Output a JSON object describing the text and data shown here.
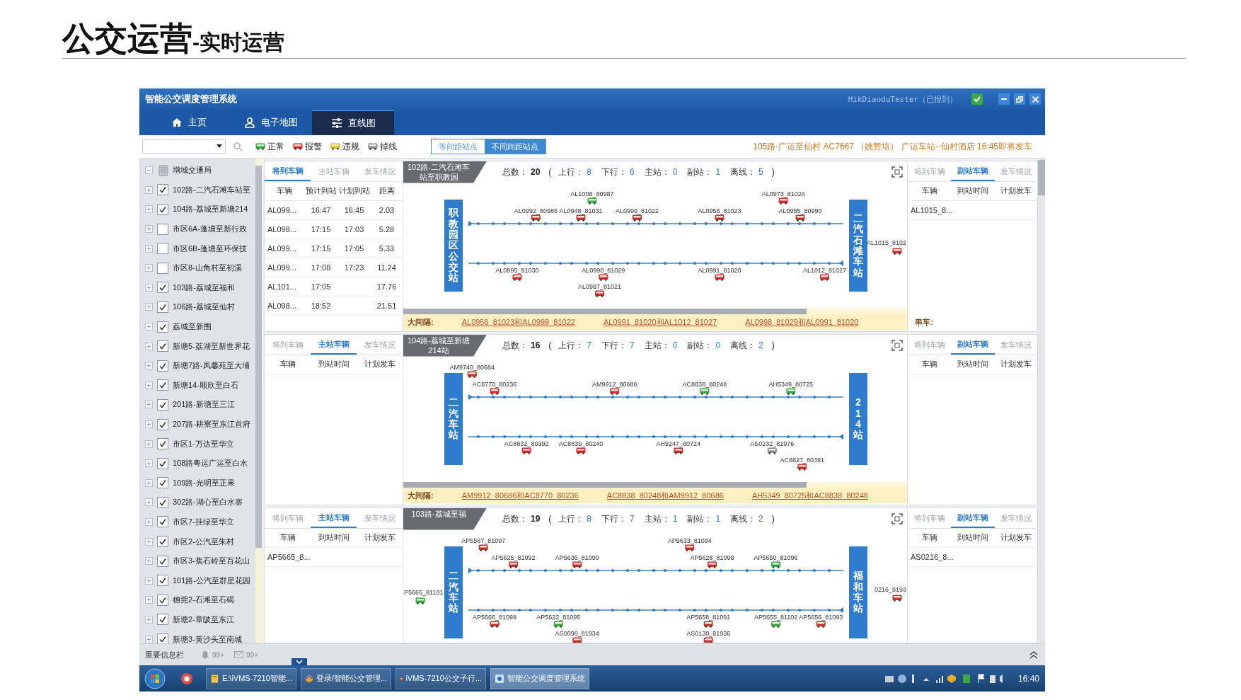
{
  "slide": {
    "title": "公交运营",
    "subtitle": "-实时运营"
  },
  "window": {
    "title": "智能公交调度管理系统",
    "user": "HikDiaoduTester（已报到）"
  },
  "tabs": [
    {
      "label": "主页",
      "selected": false
    },
    {
      "label": "电子地图",
      "selected": false
    },
    {
      "label": "直线图",
      "selected": true
    }
  ],
  "toolbar": {
    "legend": [
      {
        "label": "正常",
        "color": "#3aa845"
      },
      {
        "label": "报警",
        "color": "#c9302c"
      },
      {
        "label": "违规",
        "color": "#e2b321"
      },
      {
        "label": "掉线",
        "color": "#8a8a8a"
      }
    ],
    "view_toggle": [
      {
        "label": "等间距站点",
        "selected": false
      },
      {
        "label": "不同间距站点",
        "selected": true
      }
    ],
    "notice": "105路-广运至仙村 AC7667 （姚赞培） 广运车站--仙村酒店 16:45即将发车"
  },
  "sidebar": {
    "root": {
      "label": "增城交通局",
      "expanded": true,
      "children": [
        {
          "label": "102路-二汽石滩车站至",
          "checked": true,
          "expanded": false
        },
        {
          "label": "104路-荔城至新塘214",
          "checked": true,
          "expanded": false
        },
        {
          "label": "市区6A-蓬塘至新行政",
          "checked": false,
          "expanded": false
        },
        {
          "label": "市区6B-蓬塘至环保技",
          "checked": false,
          "expanded": false
        },
        {
          "label": "市区8-山角村至初溪",
          "checked": false,
          "expanded": false
        },
        {
          "label": "103路-荔城至福和",
          "checked": true,
          "expanded": false
        },
        {
          "label": "106路-荔城至仙村",
          "checked": true,
          "expanded": false
        },
        {
          "label": "荔城至新围",
          "checked": true,
          "expanded": false
        },
        {
          "label": "新塘5-荔湖至新世界花",
          "checked": true,
          "expanded": false
        },
        {
          "label": "新塘7路-凤馨苑至大埔",
          "checked": true,
          "expanded": false
        },
        {
          "label": "新塘14-顺欣至白石",
          "checked": true,
          "expanded": false
        },
        {
          "label": "201路-新塘至三江",
          "checked": true,
          "expanded": false
        },
        {
          "label": "207路-耕寮至东江首府",
          "checked": true,
          "expanded": false
        },
        {
          "label": "市区1-万达至华立",
          "checked": true,
          "expanded": false
        },
        {
          "label": "108路粤运广运至白水",
          "checked": true,
          "expanded": false
        },
        {
          "label": "109路-光明至正果",
          "checked": true,
          "expanded": false
        },
        {
          "label": "302路-湖心至白水寨",
          "checked": true,
          "expanded": false
        },
        {
          "label": "市区7-挂绿至华立",
          "checked": true,
          "expanded": false
        },
        {
          "label": "市区2-公汽至朱村",
          "checked": true,
          "expanded": false
        },
        {
          "label": "市区3-蕉石岭至百花山",
          "checked": true,
          "expanded": false
        },
        {
          "label": "101路-公汽至群星花园",
          "checked": true,
          "expanded": false
        },
        {
          "label": "穗莞2-石滩至石碣",
          "checked": true,
          "expanded": false
        },
        {
          "label": "新塘2-章陂至东江",
          "checked": true,
          "expanded": false
        },
        {
          "label": "新塘3-黄沙头至南城",
          "checked": true,
          "expanded": false
        }
      ]
    }
  },
  "panels": [
    {
      "left": {
        "tabs": [
          {
            "label": "将到车辆",
            "selected": true
          },
          {
            "label": "主站车辆",
            "selected": false
          },
          {
            "label": "发车情况",
            "selected": false
          }
        ],
        "columns": [
          "车辆",
          "预计到站",
          "计划到站",
          "距离"
        ],
        "rows": [
          [
            "AL099...",
            "16:47",
            "16:45",
            "2.03"
          ],
          [
            "AL098...",
            "17:15",
            "17:03",
            "5.28"
          ],
          [
            "AL099...",
            "17:15",
            "17:05",
            "5.33"
          ],
          [
            "AL099...",
            "17:08",
            "17:23",
            "11.24"
          ],
          [
            "AL101...",
            "17:05",
            "",
            "17.76"
          ],
          [
            "AL098...",
            "18:52",
            "",
            "21.51"
          ]
        ]
      },
      "route": "102路-二汽石滩车站至职教园",
      "stats": {
        "total": {
          "label": "总数：",
          "value": "20"
        },
        "open": "(",
        "items": [
          {
            "label": "上行：",
            "value": "8"
          },
          {
            "label": "下行：",
            "value": "6"
          },
          {
            "label": "主站：",
            "value": "0"
          },
          {
            "label": "副站：",
            "value": "1"
          },
          {
            "label": "离线：",
            "value": "5"
          }
        ],
        "close": ")"
      },
      "start_station": "职教园区公交站",
      "end_station": "二汽石滩车站",
      "upbound": [
        {
          "label": "AL1008_80987",
          "color": "#3aa845"
        },
        {
          "label": "AL0992_80986",
          "color": "#c9302c"
        },
        {
          "label": "AL0948_81031",
          "color": "#c9302c"
        },
        {
          "label": "AL0999_81022",
          "color": "#c9302c"
        },
        {
          "label": "AL0956_81023",
          "color": "#c9302c"
        },
        {
          "label": "AL0973_81024",
          "color": "#c9302c"
        },
        {
          "label": "AL0985_80990",
          "color": "#c9302c"
        }
      ],
      "downbound": [
        {
          "label": "AL1015_8102",
          "color": "#c9302c"
        },
        {
          "label": "AL0995_81030",
          "color": "#c9302c"
        },
        {
          "label": "AL0998_81029",
          "color": "#c9302c"
        },
        {
          "label": "AL0987_81021",
          "color": "#c9302c"
        },
        {
          "label": "AL0991_81020",
          "color": "#c9302c"
        },
        {
          "label": "AL1012_81027",
          "color": "#c9302c"
        }
      ],
      "intervals": {
        "label": "大间隔:",
        "links": [
          "AL0956_81023和AL0999_81022",
          "AL0991_81020和AL1012_81027",
          "AL0998_81029和AL0991_81020"
        ],
        "bunching": "串车:"
      },
      "right": {
        "tabs": [
          {
            "label": "将到车辆",
            "selected": false
          },
          {
            "label": "副站车辆",
            "selected": true
          },
          {
            "label": "发车情况",
            "selected": false
          }
        ],
        "columns": [
          "车辆",
          "到站时间",
          "计划发车"
        ],
        "rows": [
          [
            "AL1015_8..."
          ]
        ]
      }
    },
    {
      "left": {
        "tabs": [
          {
            "label": "将到车辆",
            "selected": false
          },
          {
            "label": "主站车辆",
            "selected": true
          },
          {
            "label": "发车情况",
            "selected": false
          }
        ],
        "columns": [
          "车辆",
          "到站时间",
          "计划发车"
        ]
      },
      "route": "104路-荔城至新塘214站",
      "stats": {
        "total": {
          "label": "总数：",
          "value": "16"
        },
        "open": "(",
        "items": [
          {
            "label": "上行：",
            "value": "7"
          },
          {
            "label": "下行：",
            "value": "7"
          },
          {
            "label": "主站：",
            "value": "0"
          },
          {
            "label": "副站：",
            "value": "0"
          },
          {
            "label": "离线：",
            "value": "2"
          }
        ],
        "close": ")"
      },
      "start_station": "二汽车站",
      "end_station": "214站",
      "upbound": [
        {
          "label": "AM9740_80684",
          "color": "#c9302c"
        },
        {
          "label": "AC8770_80236",
          "color": "#c9302c"
        },
        {
          "label": "AM9912_80686",
          "color": "#c9302c"
        },
        {
          "label": "AC8838_80248",
          "color": "#3aa845"
        },
        {
          "label": "AH5349_80725",
          "color": "#3aa845"
        }
      ],
      "downbound": [
        {
          "label": "AC8832_80392",
          "color": "#c9302c"
        },
        {
          "label": "AC8839_80240",
          "color": "#c9302c"
        },
        {
          "label": "AH9247_80724",
          "color": "#c9302c"
        },
        {
          "label": "AS0232_81976",
          "color": "#8a8a8a"
        },
        {
          "label": "AC8827_80391",
          "color": "#c9302c"
        }
      ],
      "intervals": {
        "label": "大间隔:",
        "links": [
          "AM9912_80686和AC8770_80236",
          "AC8838_80248和AM9912_80686",
          "AH5349_80725和AC8838_80248"
        ]
      },
      "right": {
        "tabs": [
          {
            "label": "将到车辆",
            "selected": false
          },
          {
            "label": "副站车辆",
            "selected": true
          },
          {
            "label": "发车情况",
            "selected": false
          }
        ],
        "columns": [
          "车辆",
          "到站时间",
          "计划发车"
        ]
      }
    },
    {
      "left": {
        "tabs": [
          {
            "label": "将到车辆",
            "selected": false
          },
          {
            "label": "主站车辆",
            "selected": true
          },
          {
            "label": "发车情况",
            "selected": false
          }
        ],
        "columns": [
          "车辆",
          "到站时间",
          "计划发车"
        ],
        "rows": [
          [
            "AP5665_8..."
          ]
        ]
      },
      "route": "103路-荔城至福",
      "stats": {
        "total": {
          "label": "总数：",
          "value": "19"
        },
        "open": "(",
        "items": [
          {
            "label": "上行：",
            "value": "8"
          },
          {
            "label": "下行：",
            "value": "7"
          },
          {
            "label": "主站：",
            "value": "1"
          },
          {
            "label": "副站：",
            "value": "1"
          },
          {
            "label": "离线：",
            "value": "2"
          }
        ],
        "close": ")"
      },
      "start_station": "二汽车站",
      "end_station": "福和车站",
      "upbound": [
        {
          "label": "AP5587_81097",
          "color": "#c9302c"
        },
        {
          "label": "AP5625_81092",
          "color": "#c9302c"
        },
        {
          "label": "AP5636_81090",
          "color": "#c9302c"
        },
        {
          "label": "AP5633_81094",
          "color": "#c9302c"
        },
        {
          "label": "AP5628_81098",
          "color": "#c9302c"
        },
        {
          "label": "AP5650_81096",
          "color": "#3aa845"
        },
        {
          "label": "P5665_81101",
          "color": "#3aa845"
        }
      ],
      "downbound": [
        {
          "label": "0216_8193",
          "color": "#c9302c"
        },
        {
          "label": "AP5666_81099",
          "color": "#c9302c"
        },
        {
          "label": "AP5622_81095",
          "color": "#3aa845"
        },
        {
          "label": "AS0096_81934",
          "color": "#c9302c"
        },
        {
          "label": "AP5658_81091",
          "color": "#c9302c"
        },
        {
          "label": "AS0130_81936",
          "color": "#c9302c"
        },
        {
          "label": "AP5655_81102",
          "color": "#3aa845"
        },
        {
          "label": "AP5656_81093",
          "color": "#c9302c"
        }
      ],
      "right": {
        "tabs": [
          {
            "label": "将到车辆",
            "selected": false
          },
          {
            "label": "副站车辆",
            "selected": true
          },
          {
            "label": "发车情况",
            "selected": false
          }
        ],
        "columns": [
          "车辆",
          "到站时间",
          "计划发车"
        ],
        "rows": [
          [
            "AS0216_8..."
          ]
        ]
      }
    }
  ],
  "status_bar": {
    "title": "重要信息栏",
    "alerts": "99+",
    "messages": "99+"
  },
  "taskbar": {
    "items": [
      {
        "label": "E:\\iVMS-7210智能...",
        "selected": false
      },
      {
        "label": "登录/智能公交管理...",
        "selected": false
      },
      {
        "label": "iVMS-7210公交子行...",
        "selected": false
      },
      {
        "label": "智能公交调度管理系统",
        "selected": true
      }
    ],
    "clock": "16:40"
  }
}
